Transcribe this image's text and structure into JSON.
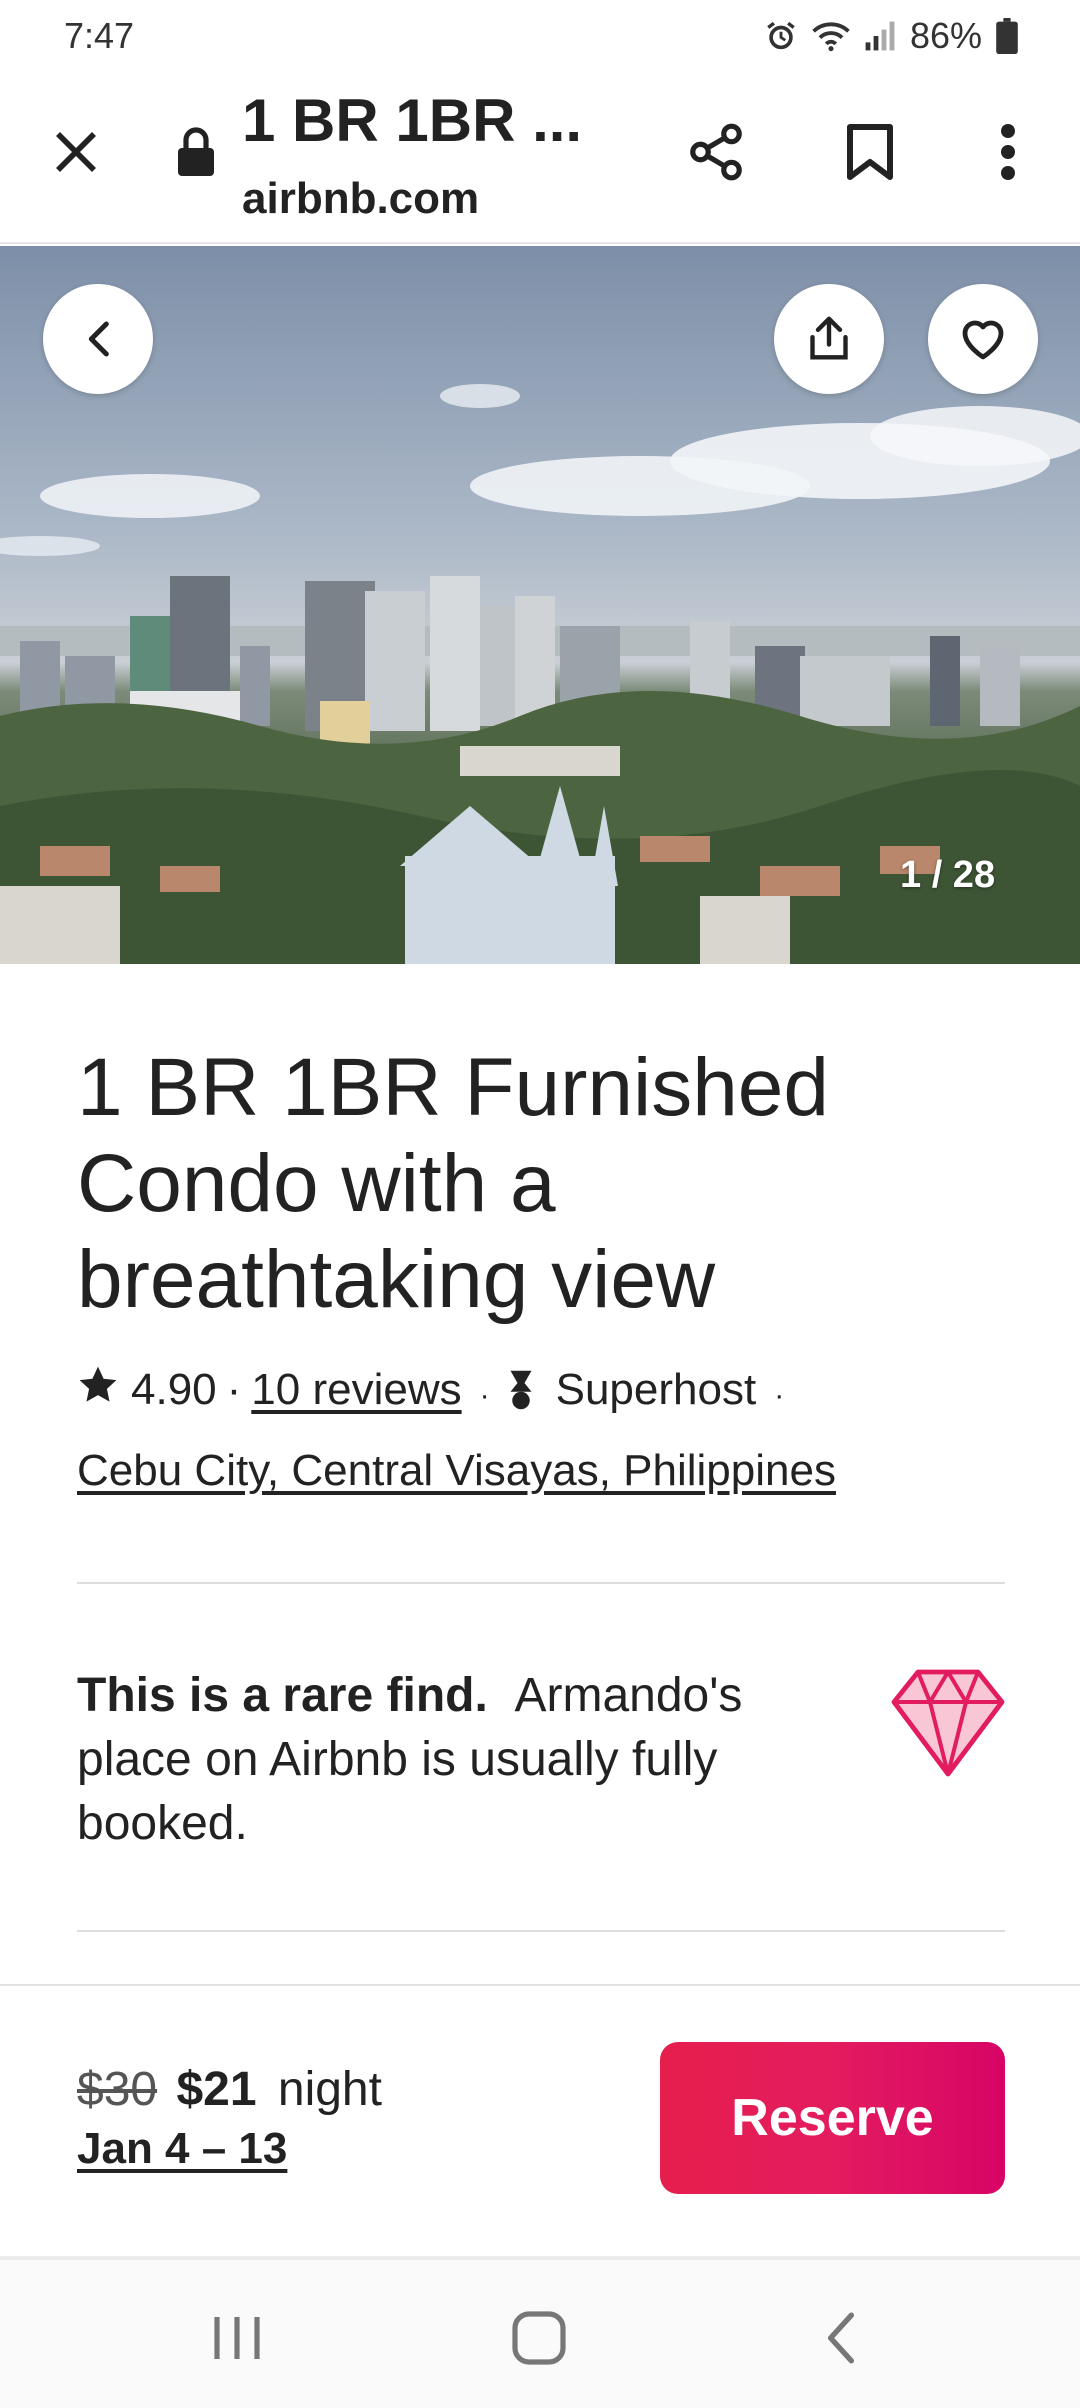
{
  "status_bar": {
    "time": "7:47",
    "battery": "86%",
    "icons": [
      "alarm-icon",
      "wifi-icon",
      "signal-icon",
      "battery-icon"
    ]
  },
  "browser": {
    "title": "1 BR 1BR ...",
    "domain": "airbnb.com",
    "icons": [
      "close-icon",
      "lock-icon",
      "share-icon",
      "bookmark-icon",
      "more-icon"
    ]
  },
  "hero": {
    "photo_counter": "1 / 28",
    "icons": [
      "back-arrow-icon",
      "upload-icon",
      "heart-icon"
    ]
  },
  "listing": {
    "title": "1 BR 1BR Furnished Condo with a breathtaking view",
    "rating": "4.90",
    "separator": "·",
    "reviews": "10 reviews",
    "host_badge": "Superhost",
    "location": "Cebu City, Central Visayas, Philippines"
  },
  "rare_find": {
    "headline": "This is a rare find.",
    "body": "Armando's place on Airbnb is usually fully booked.",
    "icon": "diamond-icon"
  },
  "reserve": {
    "old_price": "$30",
    "new_price": "$21",
    "unit": "night",
    "dates": "Jan 4 – 13",
    "button_label": "Reserve"
  },
  "nav": {
    "icons": [
      "recent-apps-icon",
      "home-icon",
      "back-icon"
    ]
  },
  "colors": {
    "accent": "#e31c5f",
    "text": "#222222",
    "divider": "#dddddd"
  }
}
